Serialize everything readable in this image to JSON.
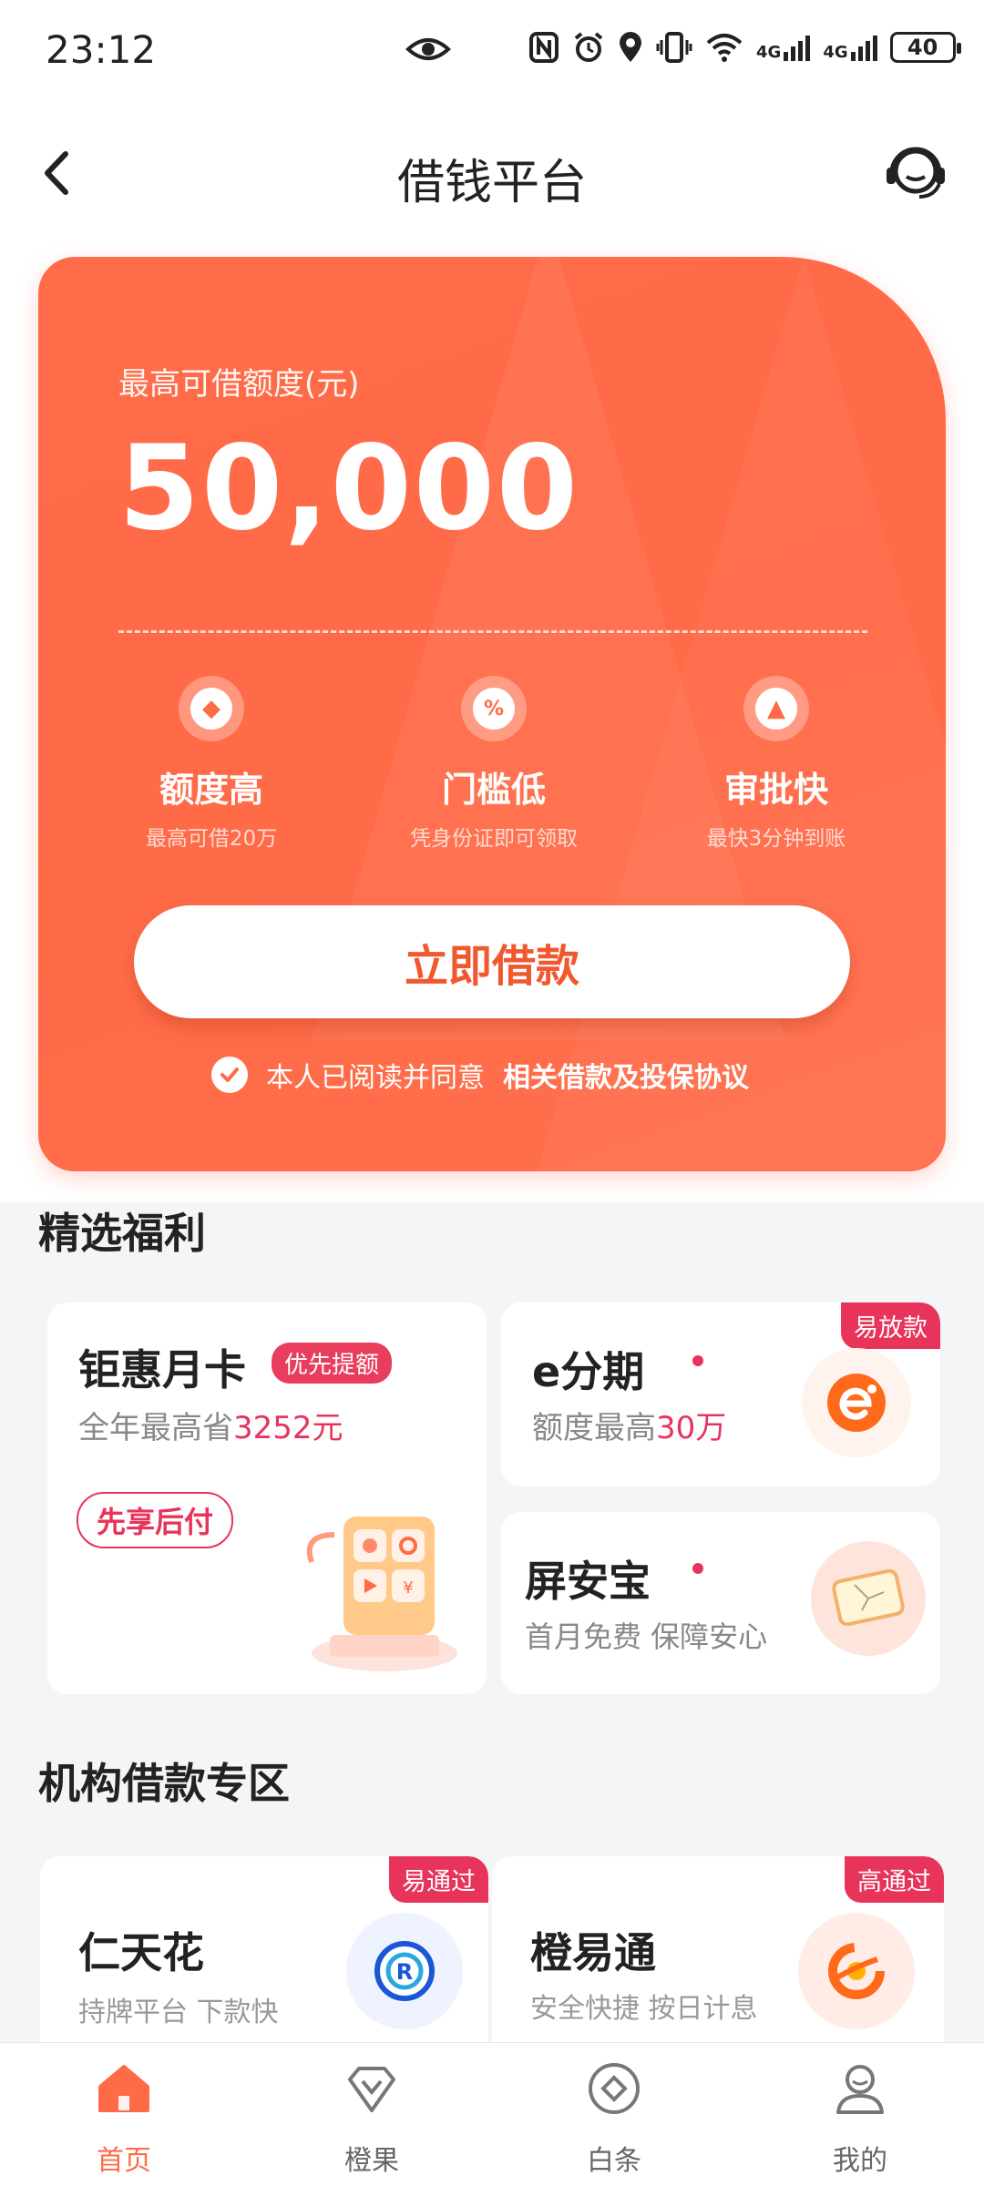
{
  "status_bar": {
    "time": "23:12",
    "battery": "40",
    "network": "4G"
  },
  "nav": {
    "title": "借钱平台"
  },
  "hero": {
    "label": "最高可借额度(元)",
    "amount": "50,000",
    "features": [
      {
        "title": "额度高",
        "sub": "最高可借20万",
        "icon": "drop-icon"
      },
      {
        "title": "门槛低",
        "sub": "凭身份证即可领取",
        "icon": "discount-icon"
      },
      {
        "title": "审批快",
        "sub": "最快3分钟到账",
        "icon": "stamp-icon"
      }
    ],
    "button": "立即借款",
    "agree_text": "本人已阅读并同意",
    "agree_link": "相关借款及投保协议"
  },
  "welfare": {
    "title": "精选福利",
    "monthly_card": {
      "title": "钜惠月卡",
      "tag": "优先提额",
      "sub_prefix": "全年最高省",
      "sub_highlight": "3252元",
      "button": "先享后付"
    },
    "installment": {
      "title": "e分期",
      "corner": "易放款",
      "sub_prefix": "额度最高",
      "sub_highlight": "30万"
    },
    "screen_insurance": {
      "title": "屏安宝",
      "sub": "首月免费 保障安心"
    }
  },
  "institutions": {
    "title": "机构借款专区",
    "items": [
      {
        "title": "仁天花",
        "sub": "持牌平台 下款快",
        "corner": "易通过"
      },
      {
        "title": "橙易通",
        "sub": "安全快捷 按日计息",
        "corner": "高通过"
      }
    ]
  },
  "tabbar": {
    "items": [
      {
        "label": "首页",
        "active": true
      },
      {
        "label": "橙果",
        "active": false
      },
      {
        "label": "白条",
        "active": false
      },
      {
        "label": "我的",
        "active": false
      }
    ]
  },
  "colors": {
    "accent": "#ff6a47",
    "highlight": "#e8335a",
    "background": "#f4f5f7"
  }
}
